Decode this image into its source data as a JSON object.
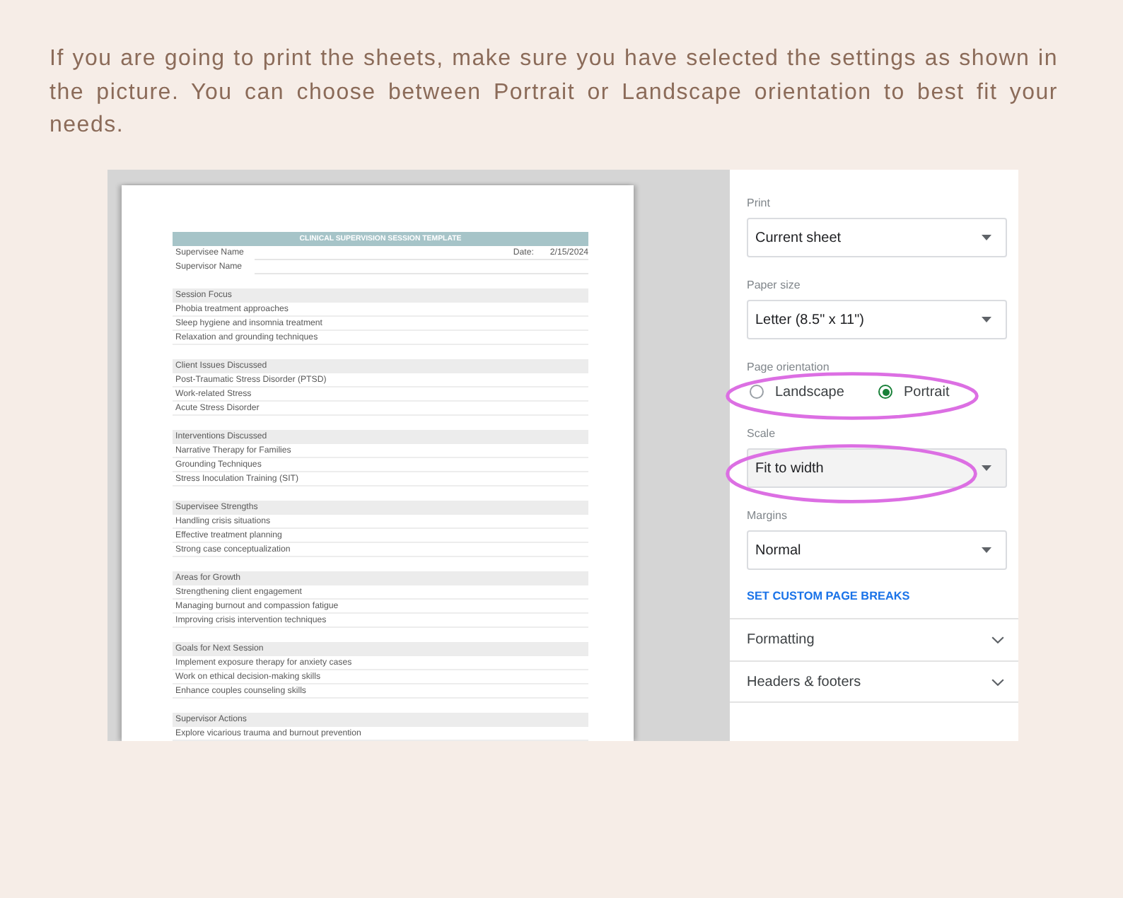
{
  "intro": {
    "text": "If you are going to print the sheets, make sure you have selected the settings as shown in the picture. You can choose between Portrait or Landscape orientation to best fit your needs."
  },
  "preview": {
    "title": "CLINICAL SUPERVISION SESSION TEMPLATE",
    "header_rows": [
      {
        "label": "Supervisee Name",
        "date_label": "Date:",
        "date_value": "2/15/2024"
      },
      {
        "label": "Supervisor Name"
      }
    ],
    "sections": [
      {
        "heading": "Session Focus",
        "items": [
          "Phobia treatment approaches",
          "Sleep hygiene and insomnia treatment",
          "Relaxation and grounding techniques"
        ]
      },
      {
        "heading": "Client Issues Discussed",
        "items": [
          "Post-Traumatic Stress Disorder (PTSD)",
          "Work-related Stress",
          "Acute Stress Disorder"
        ]
      },
      {
        "heading": "Interventions Discussed",
        "items": [
          "Narrative Therapy for Families",
          "Grounding Techniques",
          "Stress Inoculation Training (SIT)"
        ]
      },
      {
        "heading": "Supervisee Strengths",
        "items": [
          "Handling crisis situations",
          "Effective treatment planning",
          "Strong case conceptualization"
        ]
      },
      {
        "heading": "Areas for Growth",
        "items": [
          "Strengthening client engagement",
          "Managing burnout and compassion fatigue",
          "Improving crisis intervention techniques"
        ]
      },
      {
        "heading": "Goals for Next Session",
        "items": [
          "Implement exposure therapy for anxiety cases",
          "Work on ethical decision-making skills",
          "Enhance couples counseling skills"
        ]
      },
      {
        "heading": "Supervisor Actions",
        "items": [
          "Explore vicarious trauma and burnout prevention"
        ]
      }
    ]
  },
  "settings": [
    {
      "kind": "select",
      "label": "Print",
      "value": "Current sheet",
      "focused": false,
      "highlighted": false
    },
    {
      "kind": "select",
      "label": "Paper size",
      "value": "Letter (8.5\" x 11\")",
      "focused": false,
      "highlighted": false
    },
    {
      "kind": "radio",
      "label": "Page orientation",
      "options": [
        {
          "label": "Landscape",
          "selected": false
        },
        {
          "label": "Portrait",
          "selected": true
        }
      ],
      "highlighted": true
    },
    {
      "kind": "select",
      "label": "Scale",
      "value": "Fit to width",
      "focused": true,
      "highlighted": true
    },
    {
      "kind": "select",
      "label": "Margins",
      "value": "Normal",
      "focused": false,
      "highlighted": false
    },
    {
      "kind": "link",
      "label": "SET CUSTOM PAGE BREAKS",
      "highlighted": false
    },
    {
      "kind": "section",
      "label": "Formatting",
      "expanded": false,
      "highlighted": false
    },
    {
      "kind": "section",
      "label": "Headers & footers",
      "expanded": false,
      "highlighted": false
    }
  ]
}
